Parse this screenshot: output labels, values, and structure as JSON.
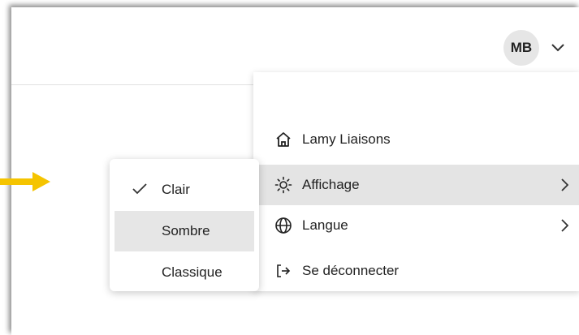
{
  "header": {
    "avatar_initials": "MB"
  },
  "account_menu": {
    "items": [
      {
        "label": "Lamy Liaisons",
        "icon": "home-icon"
      },
      {
        "label": "Affichage",
        "icon": "sun-icon",
        "has_submenu": true,
        "active": true
      },
      {
        "label": "Langue",
        "icon": "globe-icon",
        "has_submenu": true
      },
      {
        "label": "Se déconnecter",
        "icon": "logout-icon"
      }
    ]
  },
  "display_submenu": {
    "items": [
      {
        "label": "Clair",
        "selected": true
      },
      {
        "label": "Sombre",
        "hovered": true
      },
      {
        "label": "Classique"
      }
    ]
  },
  "annotation": {
    "pointer_color": "#f5c400",
    "icon": "arrow-right-icon"
  },
  "colors": {
    "active_item_bg": "#e4e4e4",
    "avatar_bg": "#e6e6e6"
  }
}
